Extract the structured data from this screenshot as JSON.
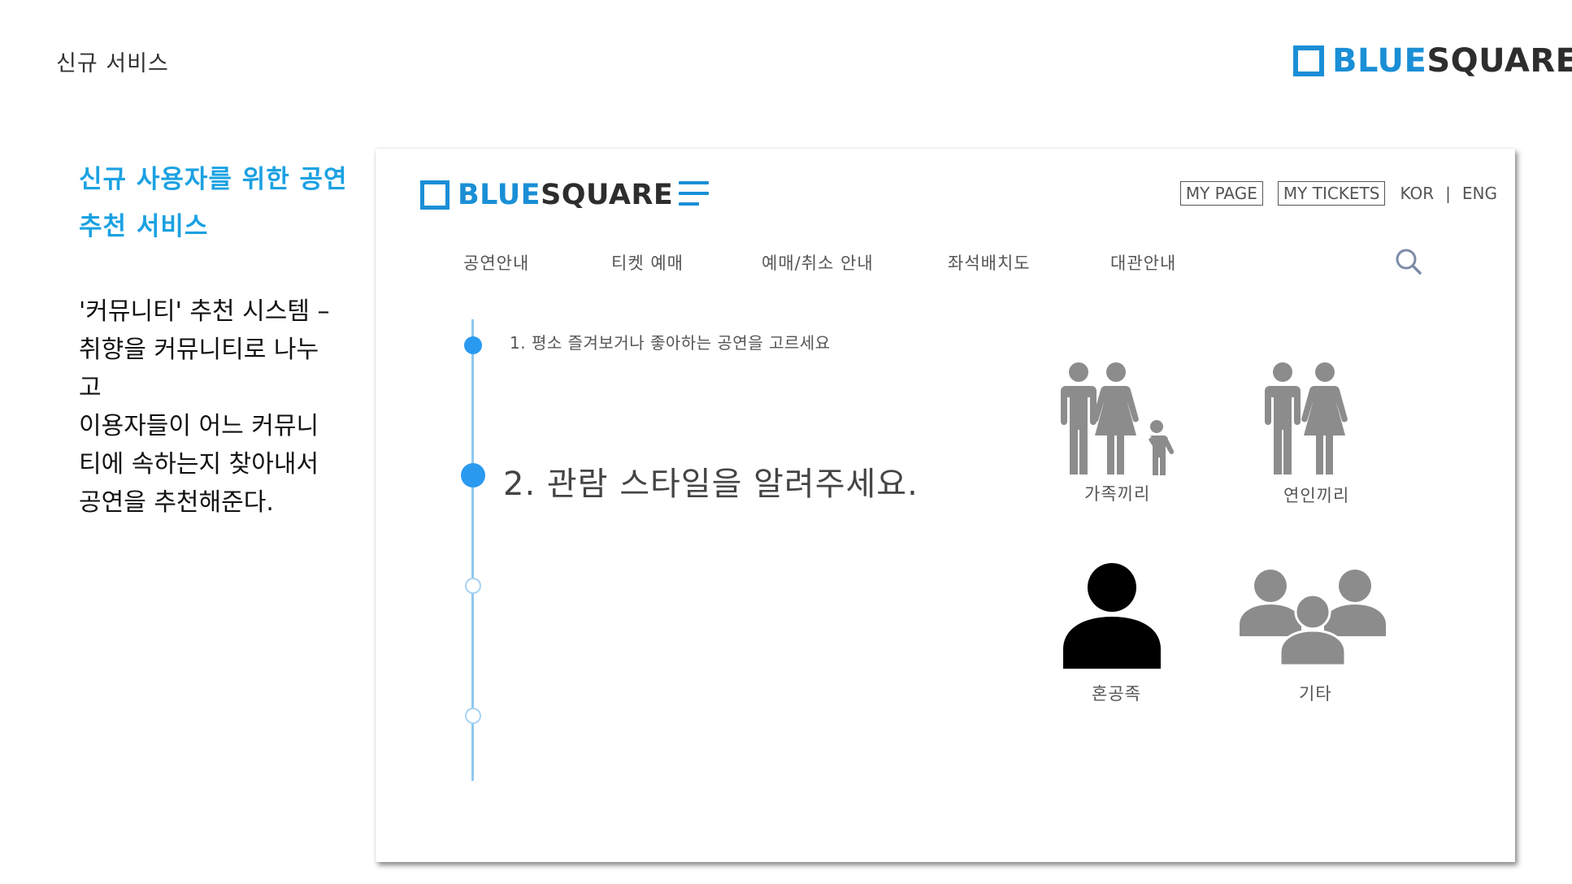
{
  "slide": {
    "title": "신규 서비스",
    "logo": {
      "part1": "BLUE",
      "part2": "SQUARE"
    },
    "heading_line1": "신규 사용자를 위한 공연",
    "heading_line2": "추천 서비스",
    "description": "'커뮤니티' 추천 시스템 –\n취향을 커뮤니티로 나누\n고\n이용자들이 어느 커뮤니\n티에 속하는지 찾아내서\n공연을 추천해준다."
  },
  "app": {
    "logo": {
      "part1": "BLUE",
      "part2": "SQUARE"
    },
    "header_links": {
      "my_page": "MY PAGE",
      "my_tickets": "MY TICKETS",
      "kor": "KOR",
      "separator": "|",
      "eng": "ENG"
    },
    "nav": [
      "공연안내",
      "티켓 예매",
      "예매/취소 안내",
      "좌석배치도",
      "대관안내"
    ],
    "steps": {
      "step1": "1. 평소 즐겨보거나 좋아하는 공연을 고르세요",
      "step2": "2. 관람 스타일을 알려주세요."
    },
    "options": [
      {
        "label": "가족끼리",
        "icon": "family-icon"
      },
      {
        "label": "연인끼리",
        "icon": "couple-icon"
      },
      {
        "label": "혼공족",
        "icon": "person-icon"
      },
      {
        "label": "기타",
        "icon": "group-icon"
      }
    ]
  },
  "colors": {
    "brand_blue": "#1a8fd6",
    "heading_blue": "#1ba1e2",
    "timeline": "#8fc8ef",
    "icon_gray": "#8c8c8c",
    "icon_black": "#000000"
  }
}
